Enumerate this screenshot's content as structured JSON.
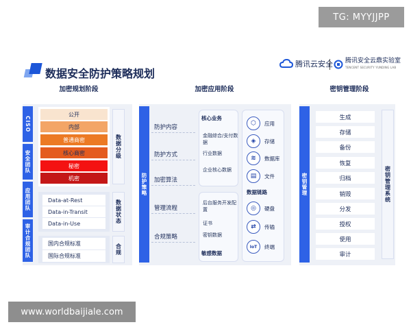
{
  "watermark_top": "TG: MYYJJPP",
  "watermark_bottom": "www.worldbaijiale.com",
  "title": "数据安全防护策略规划",
  "brand": {
    "left": "腾讯云安全",
    "right": "腾讯安全云鼎实验室",
    "right_en": "TENCENT SECURITY YUNDING LAB"
  },
  "phases": {
    "planning": "加密规划阶段",
    "application": "加密应用阶段",
    "key_mgmt": "密钥管理阶段"
  },
  "left": {
    "roles": [
      "CISO",
      "安全团队",
      "应用团队",
      "审计合规团队"
    ],
    "classification_label": "数据分级",
    "classification": [
      {
        "text": "公开",
        "bg": "#f9e4cf",
        "fg": "#1d2d5a"
      },
      {
        "text": "内部",
        "bg": "#f3a566",
        "fg": "#1d2d5a"
      },
      {
        "text": "普通商密",
        "bg": "#ec7a24",
        "fg": "#ffffff"
      },
      {
        "text": "核心商密",
        "bg": "#e45b1e",
        "fg": "#1d2d5a"
      },
      {
        "text": "秘密",
        "bg": "#f41212",
        "fg": "#ffffff"
      },
      {
        "text": "机密",
        "bg": "#c41717",
        "fg": "#ffffff"
      }
    ],
    "state_label": "数据状态",
    "states": [
      "Data-at-Rest",
      "Data-in-Transit",
      "Data-in-Use"
    ],
    "compliance_label": "合规",
    "compliance": [
      "国内合规标准",
      "国际合规标准"
    ]
  },
  "middle": {
    "strategy_label": "防护策略",
    "items": [
      "防护内容",
      "防护方式",
      "加密算法",
      "管理流程",
      "合规策略"
    ],
    "core_business": {
      "title": "核心业务",
      "items": [
        "金融综合/支付数据",
        "行业数据",
        "企业核心数据"
      ]
    },
    "data_links_title": "数据链路",
    "lower_box": {
      "items": [
        "后台服务开发配置",
        "证书",
        "密钥数据"
      ],
      "title": "敏感数据"
    },
    "icons_top": [
      {
        "icon": "app-icon",
        "glyph": "⬡",
        "label": "应用"
      },
      {
        "icon": "storage-icon",
        "glyph": "◈",
        "label": "存储"
      },
      {
        "icon": "database-icon",
        "glyph": "≋",
        "label": "数据库"
      },
      {
        "icon": "file-icon",
        "glyph": "▤",
        "label": "文件"
      }
    ],
    "icons_bottom": [
      {
        "icon": "disk-icon",
        "glyph": "◎",
        "label": "硬盘"
      },
      {
        "icon": "transfer-icon",
        "glyph": "⇄",
        "label": "传输"
      },
      {
        "icon": "iot-icon",
        "glyph": "IoT",
        "label": "终端"
      }
    ]
  },
  "right": {
    "bar_label": "密钥管理",
    "side_label": "密钥管理系统",
    "items": [
      "生成",
      "存储",
      "备份",
      "恢复",
      "归档",
      "销毁",
      "分发",
      "授权",
      "使用",
      "审计"
    ]
  },
  "colors": {
    "accent": "#2e62e6",
    "panel": "#eef1f7",
    "title": "#1d2d5a"
  }
}
